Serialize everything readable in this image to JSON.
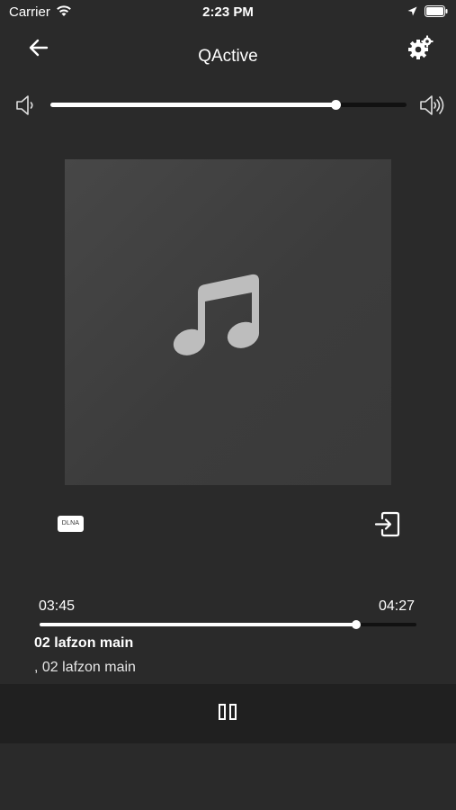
{
  "status_bar": {
    "carrier": "Carrier",
    "time": "2:23 PM"
  },
  "nav": {
    "title": "QActive",
    "back_icon": "arrow-left-icon",
    "settings_icon": "gear-icon"
  },
  "volume": {
    "level": 0.8,
    "min_icon": "speaker-low-icon",
    "max_icon": "speaker-high-icon"
  },
  "artwork": {
    "icon": "music-note-icon"
  },
  "source": {
    "badge": "DLNA",
    "exit_icon": "exit-icon"
  },
  "progress": {
    "current": "03:45",
    "total": "04:27",
    "fraction": 0.84
  },
  "track": {
    "title": "02 lafzon main",
    "subtitle": ", 02 lafzon main"
  },
  "controls": {
    "pause_icon": "pause-icon"
  },
  "colors": {
    "background": "#2a2a2a",
    "control_bar": "#202020",
    "accent": "#ffffff"
  }
}
